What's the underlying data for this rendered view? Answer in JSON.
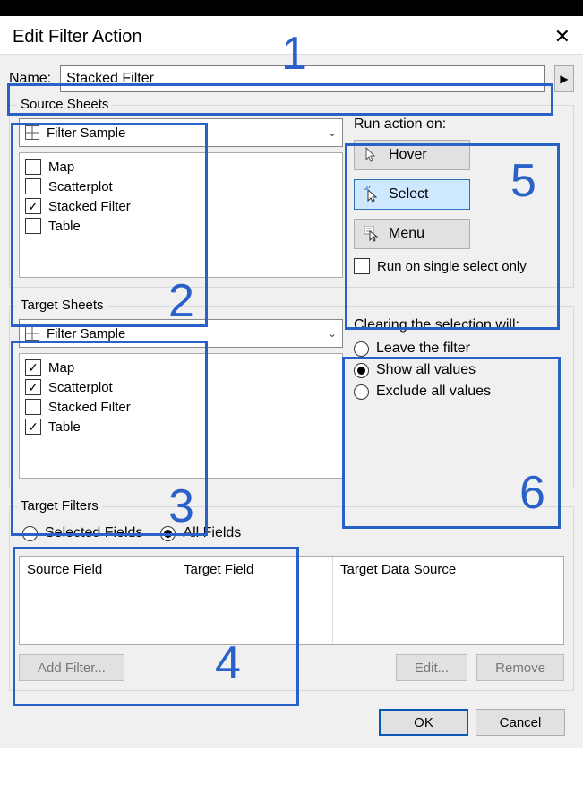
{
  "title": "Edit Filter Action",
  "name_label": "Name:",
  "name_value": "Stacked Filter",
  "source_sheets": {
    "legend": "Source Sheets",
    "combo": "Filter Sample",
    "items": [
      {
        "label": "Map",
        "checked": false
      },
      {
        "label": "Scatterplot",
        "checked": false
      },
      {
        "label": "Stacked Filter",
        "checked": true
      },
      {
        "label": "Table",
        "checked": false
      }
    ]
  },
  "run_action": {
    "label": "Run action on:",
    "hover": "Hover",
    "select": "Select",
    "menu": "Menu",
    "single_select": "Run on single select only",
    "single_select_checked": false
  },
  "target_sheets": {
    "legend": "Target Sheets",
    "combo": "Filter Sample",
    "items": [
      {
        "label": "Map",
        "checked": true
      },
      {
        "label": "Scatterplot",
        "checked": true
      },
      {
        "label": "Stacked Filter",
        "checked": false
      },
      {
        "label": "Table",
        "checked": true
      }
    ]
  },
  "clearing": {
    "label": "Clearing the selection will:",
    "options": [
      "Leave the filter",
      "Show all values",
      "Exclude all values"
    ],
    "selected_index": 1
  },
  "target_filters": {
    "legend": "Target Filters",
    "radio_selected": "Selected Fields",
    "radio_all": "All Fields",
    "radio_selected_index": 1,
    "columns": [
      "Source Field",
      "Target Field",
      "Target Data Source"
    ],
    "add_btn": "Add Filter...",
    "edit_btn": "Edit...",
    "remove_btn": "Remove"
  },
  "buttons": {
    "ok": "OK",
    "cancel": "Cancel"
  },
  "annotations": [
    "1",
    "2",
    "3",
    "4",
    "5",
    "6"
  ]
}
